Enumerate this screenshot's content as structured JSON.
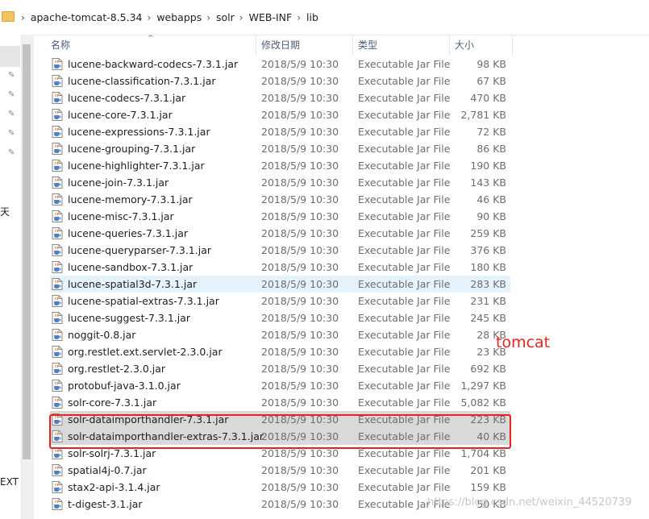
{
  "address": {
    "path": [
      "apache-tomcat-8.5.34",
      "webapps",
      "solr",
      "WEB-INF",
      "lib"
    ]
  },
  "left_pane": {
    "fragments": [
      "天",
      "EXT ("
    ]
  },
  "columns": {
    "name": "名称",
    "modified": "修改日期",
    "type": "类型",
    "size": "大小"
  },
  "files": [
    {
      "name": "lucene-backward-codecs-7.3.1.jar",
      "modified": "2018/5/9 10:30",
      "type": "Executable Jar File",
      "size": "98 KB"
    },
    {
      "name": "lucene-classification-7.3.1.jar",
      "modified": "2018/5/9 10:30",
      "type": "Executable Jar File",
      "size": "67 KB"
    },
    {
      "name": "lucene-codecs-7.3.1.jar",
      "modified": "2018/5/9 10:30",
      "type": "Executable Jar File",
      "size": "470 KB"
    },
    {
      "name": "lucene-core-7.3.1.jar",
      "modified": "2018/5/9 10:30",
      "type": "Executable Jar File",
      "size": "2,781 KB"
    },
    {
      "name": "lucene-expressions-7.3.1.jar",
      "modified": "2018/5/9 10:30",
      "type": "Executable Jar File",
      "size": "72 KB"
    },
    {
      "name": "lucene-grouping-7.3.1.jar",
      "modified": "2018/5/9 10:30",
      "type": "Executable Jar File",
      "size": "86 KB"
    },
    {
      "name": "lucene-highlighter-7.3.1.jar",
      "modified": "2018/5/9 10:30",
      "type": "Executable Jar File",
      "size": "190 KB"
    },
    {
      "name": "lucene-join-7.3.1.jar",
      "modified": "2018/5/9 10:30",
      "type": "Executable Jar File",
      "size": "143 KB"
    },
    {
      "name": "lucene-memory-7.3.1.jar",
      "modified": "2018/5/9 10:30",
      "type": "Executable Jar File",
      "size": "46 KB"
    },
    {
      "name": "lucene-misc-7.3.1.jar",
      "modified": "2018/5/9 10:30",
      "type": "Executable Jar File",
      "size": "90 KB"
    },
    {
      "name": "lucene-queries-7.3.1.jar",
      "modified": "2018/5/9 10:30",
      "type": "Executable Jar File",
      "size": "259 KB"
    },
    {
      "name": "lucene-queryparser-7.3.1.jar",
      "modified": "2018/5/9 10:30",
      "type": "Executable Jar File",
      "size": "376 KB"
    },
    {
      "name": "lucene-sandbox-7.3.1.jar",
      "modified": "2018/5/9 10:30",
      "type": "Executable Jar File",
      "size": "180 KB"
    },
    {
      "name": "lucene-spatial3d-7.3.1.jar",
      "modified": "2018/5/9 10:30",
      "type": "Executable Jar File",
      "size": "283 KB"
    },
    {
      "name": "lucene-spatial-extras-7.3.1.jar",
      "modified": "2018/5/9 10:30",
      "type": "Executable Jar File",
      "size": "231 KB"
    },
    {
      "name": "lucene-suggest-7.3.1.jar",
      "modified": "2018/5/9 10:30",
      "type": "Executable Jar File",
      "size": "245 KB"
    },
    {
      "name": "noggit-0.8.jar",
      "modified": "2018/5/9 10:30",
      "type": "Executable Jar File",
      "size": "28 KB"
    },
    {
      "name": "org.restlet.ext.servlet-2.3.0.jar",
      "modified": "2018/5/9 10:30",
      "type": "Executable Jar File",
      "size": "23 KB"
    },
    {
      "name": "org.restlet-2.3.0.jar",
      "modified": "2018/5/9 10:30",
      "type": "Executable Jar File",
      "size": "692 KB"
    },
    {
      "name": "protobuf-java-3.1.0.jar",
      "modified": "2018/5/9 10:30",
      "type": "Executable Jar File",
      "size": "1,297 KB"
    },
    {
      "name": "solr-core-7.3.1.jar",
      "modified": "2018/5/9 10:30",
      "type": "Executable Jar File",
      "size": "5,082 KB"
    },
    {
      "name": "solr-dataimporthandler-7.3.1.jar",
      "modified": "2018/5/9 10:30",
      "type": "Executable Jar File",
      "size": "223 KB"
    },
    {
      "name": "solr-dataimporthandler-extras-7.3.1.jar",
      "modified": "2018/5/9 10:30",
      "type": "Executable Jar File",
      "size": "40 KB"
    },
    {
      "name": "solr-solrj-7.3.1.jar",
      "modified": "2018/5/9 10:30",
      "type": "Executable Jar File",
      "size": "1,704 KB"
    },
    {
      "name": "spatial4j-0.7.jar",
      "modified": "2018/5/9 10:30",
      "type": "Executable Jar File",
      "size": "201 KB"
    },
    {
      "name": "stax2-api-3.1.4.jar",
      "modified": "2018/5/9 10:30",
      "type": "Executable Jar File",
      "size": "159 KB"
    },
    {
      "name": "t-digest-3.1.jar",
      "modified": "2018/5/9 10:30",
      "type": "Executable Jar File",
      "size": "50 KB"
    }
  ],
  "hovered_index": 13,
  "selected_indices": [
    21,
    22
  ],
  "annotation": {
    "text": "tomcat",
    "color": "#e8231f"
  },
  "watermark": "https://blog.csdn.net/weixin_44520739",
  "colors": {
    "header_text": "#4c607a",
    "hover_row": "#e5f3ff",
    "selected_row": "#d9d9d9",
    "highlight_box": "#e8231f"
  }
}
